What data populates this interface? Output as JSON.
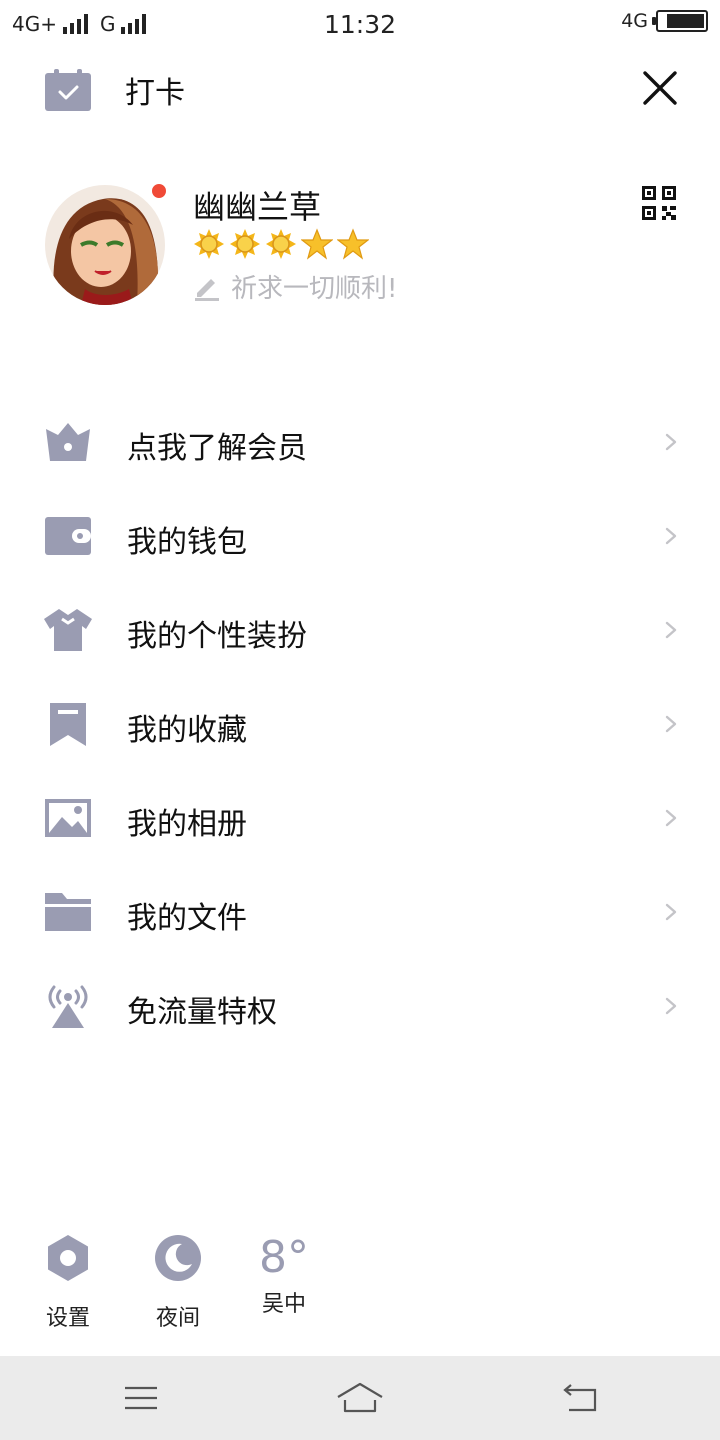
{
  "status_bar": {
    "left_network_1": "4G+",
    "left_network_2": "G",
    "time": "11:32",
    "right_network": "4G",
    "battery_level": 0.85
  },
  "header": {
    "checkin_label": "打卡",
    "checkin_icon": "calendar-check-icon",
    "close_icon": "close-icon"
  },
  "profile": {
    "nickname": "幽幽兰草",
    "signature": "祈求一切顺利!",
    "level_badges": [
      "sun",
      "sun",
      "sun",
      "star",
      "star"
    ],
    "has_notification_dot": true,
    "qr_icon": "qr-code-icon"
  },
  "menu": {
    "items": [
      {
        "label": "点我了解会员",
        "icon": "vip-basket-icon"
      },
      {
        "label": "我的钱包",
        "icon": "wallet-icon"
      },
      {
        "label": "我的个性装扮",
        "icon": "tshirt-icon"
      },
      {
        "label": "我的收藏",
        "icon": "bookmark-icon"
      },
      {
        "label": "我的相册",
        "icon": "photo-icon"
      },
      {
        "label": "我的文件",
        "icon": "folder-icon"
      },
      {
        "label": "免流量特权",
        "icon": "signal-tower-icon"
      }
    ]
  },
  "bottom_tools": {
    "settings_label": "设置",
    "night_label": "夜间",
    "weather_temp": "8°",
    "weather_city": "吴中"
  },
  "colors": {
    "icon_gray": "#9a9cb2",
    "chevron": "#c4c4c8",
    "badge_red": "#f04a37",
    "navbar_bg": "#ebebeb"
  }
}
